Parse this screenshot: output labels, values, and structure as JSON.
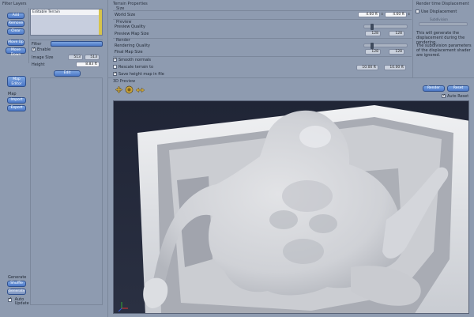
{
  "left": {
    "title": "Filter Layers",
    "buttons": {
      "add": "Add",
      "remove": "Remove",
      "clear": "Clear",
      "move_up": "Move Up",
      "move_down": "Move Down"
    },
    "layer_item": "Editable Terrain",
    "filter_label": "Filter",
    "enable_label": "Enable",
    "image_size_label": "Image Size",
    "image_size_w": "513",
    "image_size_h": "513",
    "height_label": "Height",
    "height_value": "8.83 ft",
    "edit_button": "Edit",
    "map_editor_button": "Map\nEditor",
    "map_section": "Map",
    "import_button": "Import",
    "export_button": "Export",
    "generate_label": "Generate",
    "shuffle_button": "Shuffle",
    "generate_button": "Generate",
    "auto_update_label": "Auto Update"
  },
  "terrain": {
    "title": "Terrain Properties",
    "size_section": "Size",
    "world_size_label": "World Size",
    "world_size_x": "4.60 ft",
    "world_size_y": "4.60 ft",
    "preview_section": "Preview",
    "preview_quality_label": "Preview Quality",
    "preview_map_size_label": "Preview Map Size",
    "preview_map_w": "128",
    "preview_map_h": "128",
    "render_section": "Render",
    "rendering_quality_label": "Rendering Quality",
    "final_map_size_label": "Final Map Size",
    "final_map_w": "128",
    "final_map_h": "128",
    "smooth_normals_label": "Smooth normals",
    "rescale_label": "Rescale terrain to",
    "rescale_w": "10.00 ft",
    "rescale_h": "10.00 ft",
    "save_height_label": "Save height map in file"
  },
  "displacement": {
    "title": "Render time Displacement",
    "use_label": "Use Displacement",
    "subdivision_label": "Subdivision",
    "note1": "This will generate the displacement during the rendering.",
    "note2": "The subdivision parameters of the displacement shader are ignored."
  },
  "preview3d": {
    "title": "3D Preview",
    "render_button": "Render",
    "reset_button": "Reset",
    "auto_reset_label": "Auto Reset"
  },
  "icons": [
    "move-icon",
    "rotate-icon",
    "zoom-icon",
    "axis-icon"
  ]
}
